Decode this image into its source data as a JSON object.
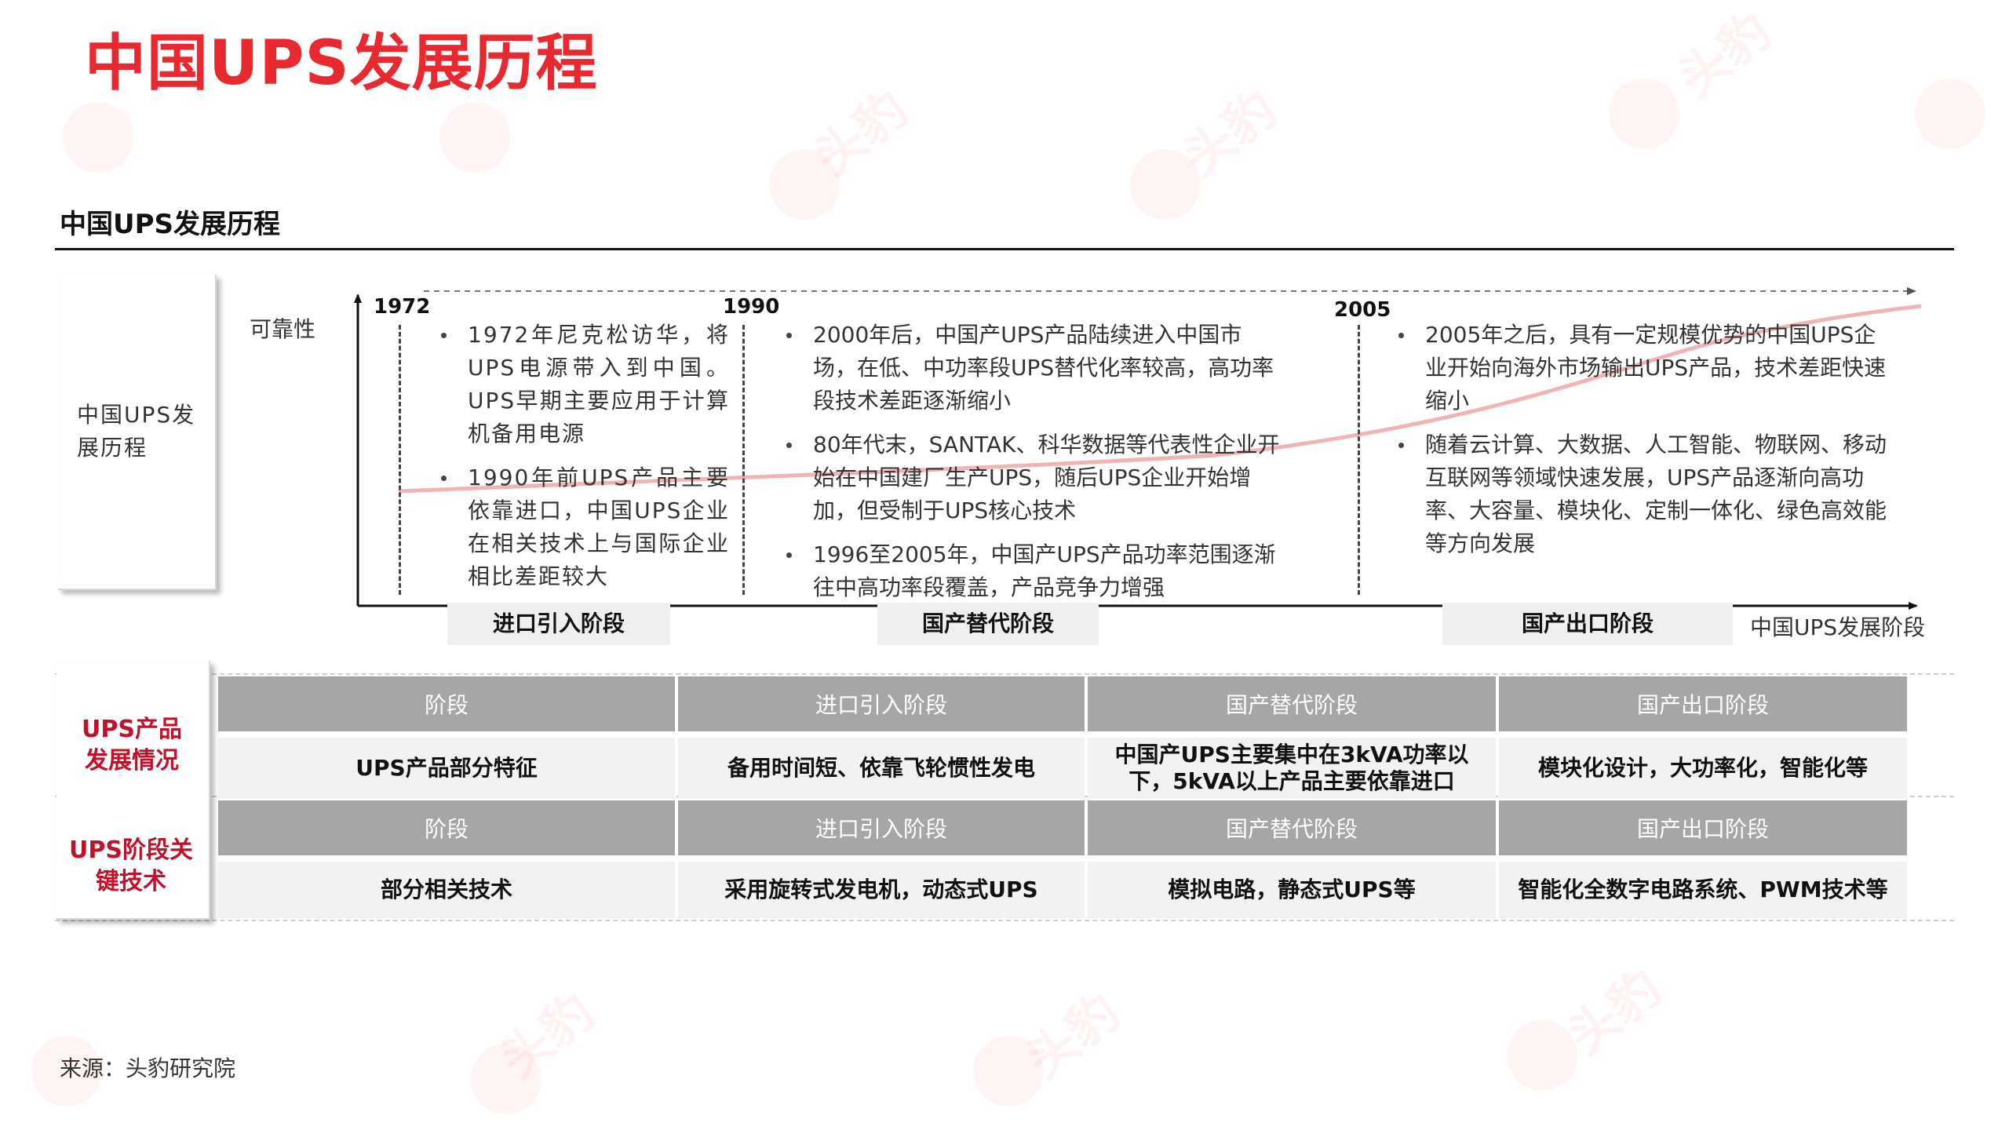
{
  "title": "中国UPS发展历程",
  "section": {
    "title": "中国UPS发展历程"
  },
  "timeline": {
    "side_label": "中国UPS发展历程",
    "y_axis_label": "可靠性",
    "x_axis_label": "中国UPS发展阶段",
    "years": [
      "1972",
      "1990",
      "2005"
    ],
    "stages": [
      "进口引入阶段",
      "国产替代阶段",
      "国产出口阶段"
    ],
    "columns": [
      {
        "bullets": [
          "1972年尼克松访华，将UPS电源带入到中国。UPS早期主要应用于计算机备用电源",
          "1990年前UPS产品主要依靠进口，中国UPS企业在相关技术上与国际企业相比差距较大"
        ]
      },
      {
        "bullets": [
          "2000年后，中国产UPS产品陆续进入中国市场，在低、中功率段UPS替代化率较高，高功率段技术差距逐渐缩小",
          "80年代末，SANTAK、科华数据等代表性企业开始在中国建厂生产UPS，随后UPS企业开始增加，但受制于UPS核心技术",
          "1996至2005年，中国产UPS产品功率范围逐渐往中高功率段覆盖，产品竞争力增强"
        ]
      },
      {
        "bullets": [
          "2005年之后，具有一定规模优势的中国UPS企业开始向海外市场输出UPS产品，技术差距快速缩小",
          "随着云计算、大数据、人工智能、物联网、移动互联网等领域快速发展，UPS产品逐渐向高功率、大容量、模块化、定制一体化、绿色高效能等方向发展"
        ]
      }
    ]
  },
  "table": {
    "sections": [
      {
        "label": "UPS产品发展情况",
        "header": [
          "阶段",
          "进口引入阶段",
          "国产替代阶段",
          "国产出口阶段"
        ],
        "row": [
          "UPS产品部分特征",
          "备用时间短、依靠飞轮惯性发电",
          "中国产UPS主要集中在3kVA功率以下，5kVA以上产品主要依靠进口",
          "模块化设计，大功率化，智能化等"
        ]
      },
      {
        "label": "UPS阶段关键技术",
        "header": [
          "阶段",
          "进口引入阶段",
          "国产替代阶段",
          "国产出口阶段"
        ],
        "row": [
          "部分相关技术",
          "采用旋转式发电机，动态式UPS",
          "模拟电路，静态式UPS等",
          "智能化全数字电路系统、PWM技术等"
        ]
      }
    ]
  },
  "source": "来源：头豹研究院",
  "watermark": "头豹",
  "colors": {
    "accent": "#e8292f",
    "row_label": "#c0102a",
    "header_fill": "#a6a6a6",
    "body_fill": "#f2f2f2",
    "stage_fill": "#efefef",
    "curve": "#f0b4b4"
  }
}
